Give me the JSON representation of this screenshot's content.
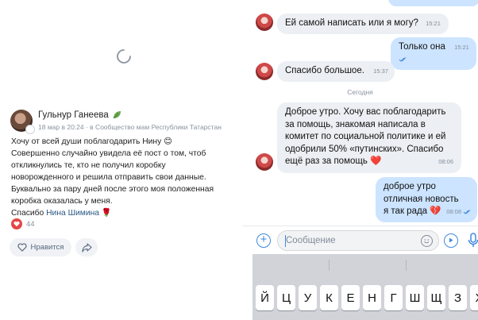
{
  "post": {
    "author": "Гульнур Ганеева",
    "meta": "18 мар в 20:24 · в Сообщество мам Республики Татарстан",
    "lines": [
      "Хочу от всей души поблагодарить Нину 😊",
      "Совершенно случайно увидела её пост о том, чтоб",
      "откликнулись те, кто не получил коробку",
      "новорожденного и решила отправить свои данные.",
      "Буквально за пару дней после этого моя положенная",
      "коробка оказалась у меня."
    ],
    "thanks_prefix": "Спасибо ",
    "mention": "Нина Шимина",
    "thanks_suffix": " 🌹",
    "likes_count": "44",
    "like_label": "Нравится"
  },
  "chat": {
    "messages": [
      {
        "text": "Ей самой написать или я могу?",
        "time": "15:21"
      },
      {
        "text": "Только она",
        "time": "15:21"
      },
      {
        "text": "Спасибо большое.",
        "time": "15:37"
      },
      {
        "lines": [
          "Доброе утро. Хочу вас поблагодарить",
          "за помощь, знакомая написала в",
          "комитет по социальной политике и ей",
          "одобрили 50% «путинских». Спасибо",
          "ещё раз за помощь ❤️"
        ],
        "time": "08:06"
      },
      {
        "lines": [
          "доброе утро",
          "отличная новость",
          "я так рада 💔"
        ],
        "time": "08:08"
      }
    ],
    "date_separator": "Сегодня",
    "composer_placeholder": "Сообщение"
  },
  "keyboard": {
    "keys": [
      "Й",
      "Ц",
      "У",
      "К",
      "Е",
      "Н",
      "Г",
      "Ш",
      "Щ",
      "З",
      "Х"
    ]
  },
  "colors": {
    "incoming": "#eceff3",
    "outgoing": "#cce4ff",
    "accent": "#3f8ae0",
    "like_red": "#e64646"
  }
}
